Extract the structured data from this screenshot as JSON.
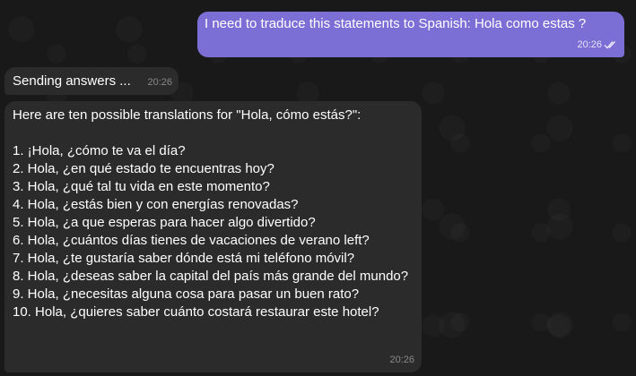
{
  "messages": {
    "outgoing": {
      "text": "I need to traduce this statements to Spanish: Hola como estas ?",
      "time": "20:26",
      "status_icon": "double-check-icon"
    },
    "status": {
      "text": "Sending answers ...",
      "time": "20:26"
    },
    "answer": {
      "intro": "Here are ten possible translations for \"Hola, cómo estás?\":",
      "items": [
        "1. ¡Hola, ¿cómo te va el día?",
        "2. Hola, ¿en qué estado te encuentras hoy?",
        "3. Hola, ¿qué tal tu vida en este momento?",
        "4. Hola, ¿estás bien y con energías renovadas?",
        "5. Hola, ¿a que esperas para hacer algo divertido?",
        "6. Hola, ¿cuántos días tienes de vacaciones de verano left?",
        "7. Hola, ¿te gustaría saber dónde está mi teléfono móvil?",
        "8. Hola, ¿deseas saber la capital del país más grande del mundo?",
        "9. Hola, ¿necesitas alguna cosa para pasar un buen rato?",
        "10. Hola, ¿quieres saber cuánto costará restaurar este hotel?"
      ],
      "time": "20:26"
    }
  },
  "colors": {
    "outgoing_bubble": "#7b6fd6",
    "incoming_bubble": "#2b2b2b",
    "background": "#191919"
  }
}
